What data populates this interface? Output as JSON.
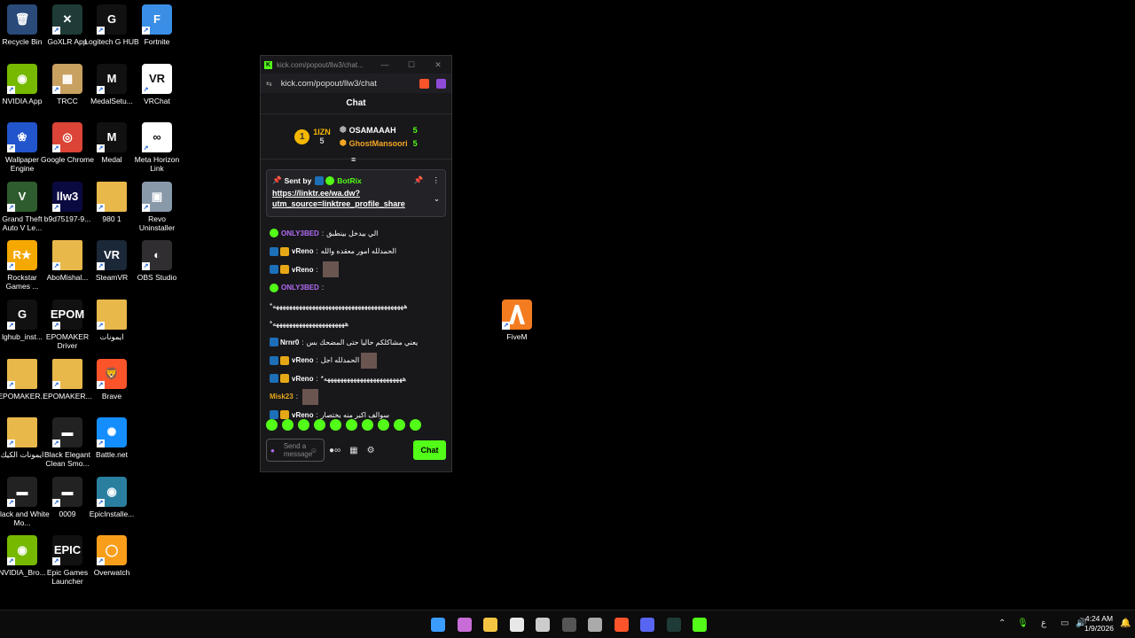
{
  "desktop": {
    "icons": [
      {
        "label": "Recycle Bin",
        "icon": "recycle-bin-icon",
        "color": "#2a4a7a",
        "glyph": "🗑"
      },
      {
        "label": "GoXLR App",
        "icon": "goxlr-icon",
        "color": "#1f3b38",
        "glyph": "✕"
      },
      {
        "label": "Logitech G HUB",
        "icon": "logitech-icon",
        "color": "#111111",
        "glyph": "G"
      },
      {
        "label": "Fortnite",
        "icon": "fortnite-icon",
        "color": "#3a8ee6",
        "glyph": "F"
      },
      {
        "label": "NVIDIA App",
        "icon": "nvidia-icon",
        "color": "#76b900",
        "glyph": "◉"
      },
      {
        "label": "TRCC",
        "icon": "trcc-icon",
        "color": "#c8a060",
        "glyph": "▦"
      },
      {
        "label": "MedalSetu...",
        "icon": "medal-icon",
        "color": "#111111",
        "glyph": "M"
      },
      {
        "label": "VRChat",
        "icon": "vrchat-icon",
        "color": "#ffffff",
        "glyph": "VR"
      },
      {
        "label": "Wallpaper Engine",
        "icon": "wallpaper-engine-icon",
        "color": "#2255cc",
        "glyph": "❀"
      },
      {
        "label": "Google Chrome",
        "icon": "chrome-icon",
        "color": "#db4437",
        "glyph": "◎"
      },
      {
        "label": "Medal",
        "icon": "medal-icon",
        "color": "#111111",
        "glyph": "M"
      },
      {
        "label": "Meta Horizon Link",
        "icon": "meta-icon",
        "color": "#ffffff",
        "glyph": "∞"
      },
      {
        "label": "Grand Theft Auto V Le...",
        "icon": "gta-icon",
        "color": "#2e5c2e",
        "glyph": "V"
      },
      {
        "label": "b9d75197-9...",
        "icon": "llw3-icon",
        "color": "#0a0a40",
        "glyph": "llw3"
      },
      {
        "label": "980 1",
        "icon": "folder-icon",
        "color": "#e8b84a",
        "glyph": ""
      },
      {
        "label": "Revo Uninstaller",
        "icon": "revo-icon",
        "color": "#8899aa",
        "glyph": "▣"
      },
      {
        "label": "Rockstar Games ...",
        "icon": "rockstar-icon",
        "color": "#f5a800",
        "glyph": "R★"
      },
      {
        "label": "AboMishal...",
        "icon": "folder-icon",
        "color": "#e8b84a",
        "glyph": ""
      },
      {
        "label": "SteamVR",
        "icon": "steamvr-icon",
        "color": "#1b2838",
        "glyph": "VR"
      },
      {
        "label": "OBS Studio",
        "icon": "obs-icon",
        "color": "#302e31",
        "glyph": "◐"
      },
      {
        "label": "lghub_inst...",
        "icon": "logitech-icon",
        "color": "#111111",
        "glyph": "G"
      },
      {
        "label": "EPOMAKER Driver",
        "icon": "epomaker-icon",
        "color": "#111111",
        "glyph": "EPOM"
      },
      {
        "label": "ايمونات",
        "icon": "folder-icon",
        "color": "#e8b84a",
        "glyph": ""
      },
      {
        "label": "",
        "icon": "",
        "color": "",
        "glyph": ""
      },
      {
        "label": "EPOMAKER...",
        "icon": "folder-icon",
        "color": "#e8b84a",
        "glyph": ""
      },
      {
        "label": "EPOMAKER...",
        "icon": "folder-icon",
        "color": "#e8b84a",
        "glyph": ""
      },
      {
        "label": "Brave",
        "icon": "brave-icon",
        "color": "#fb542b",
        "glyph": "🦁"
      },
      {
        "label": "",
        "icon": "",
        "color": "",
        "glyph": ""
      },
      {
        "label": "ايمونات الكيك",
        "icon": "folder-icon",
        "color": "#e8b84a",
        "glyph": ""
      },
      {
        "label": "Black Elegant Clean Smo...",
        "icon": "video-icon",
        "color": "#222222",
        "glyph": "▬"
      },
      {
        "label": "Battle.net",
        "icon": "battlenet-icon",
        "color": "#148eff",
        "glyph": "✺"
      },
      {
        "label": "",
        "icon": "",
        "color": "",
        "glyph": ""
      },
      {
        "label": "Black and White Mo...",
        "icon": "video-icon",
        "color": "#222222",
        "glyph": "▬"
      },
      {
        "label": "0009",
        "icon": "video-icon",
        "color": "#222222",
        "glyph": "▬"
      },
      {
        "label": "EpicInstalle...",
        "icon": "installer-icon",
        "color": "#2a7fa0",
        "glyph": "◉"
      },
      {
        "label": "",
        "icon": "",
        "color": "",
        "glyph": ""
      },
      {
        "label": "NVIDIA_Bro...",
        "icon": "nvidia-icon",
        "color": "#76b900",
        "glyph": "◉"
      },
      {
        "label": "Epic Games Launcher",
        "icon": "epic-icon",
        "color": "#111111",
        "glyph": "EPIC"
      },
      {
        "label": "Overwatch",
        "icon": "overwatch-icon",
        "color": "#f99e1a",
        "glyph": "◯"
      }
    ],
    "fivem": {
      "label": "FiveM",
      "icon": "fivem-icon",
      "color": "#f47c20"
    }
  },
  "browser": {
    "tab_title": "kick.com/popout/llw3/chat...",
    "url": "kick.com/popout/llw3/chat",
    "minimize": "—",
    "maximize": "☐",
    "close": "✕",
    "chat_title": "Chat",
    "leaderboard": {
      "rank": "1",
      "left_name": "1IZN",
      "left_count": "5",
      "entries": [
        {
          "name": "OSAMAAAH",
          "count": "5",
          "color": "#ffffff"
        },
        {
          "name": "GhostMansoori",
          "count": "5",
          "color": "#f5a623"
        }
      ]
    },
    "pinned": {
      "sent_by": "Sent by",
      "author": "BotRix",
      "link": "https://linktr.ee/wa.dw?utm_source=linktree_profile_share",
      "link_line1": "https://linktr.ee/wa.dw?",
      "link_line2": "utm_source=linktree_profile_share"
    },
    "messages": [
      {
        "user": "ONLY3BED",
        "color": "#b26cf5",
        "badges": [
          "verified"
        ],
        "text": "الي بيدخل بينطبق"
      },
      {
        "user": "vReno",
        "color": "#ffffff",
        "badges": [
          "sub",
          "crown"
        ],
        "text": "الحمدلله امور معقده والله"
      },
      {
        "user": "vReno",
        "color": "#ffffff",
        "badges": [
          "sub",
          "crown"
        ],
        "text": "",
        "emote": true
      },
      {
        "user": "ONLY3BED",
        "color": "#b26cf5",
        "badges": [
          "verified"
        ],
        "text": ""
      },
      {
        "user": "",
        "color": "#ffffff",
        "badges": [],
        "text": "*ههههههههههههههههههههههههههههههههههههههههه"
      },
      {
        "user": "",
        "color": "#ffffff",
        "badges": [],
        "text": "*ههههههههههههههههههههههه"
      },
      {
        "user": "Nrnr0",
        "color": "#ffffff",
        "badges": [
          "sub"
        ],
        "text": "يعني مشاكلكم حاليا حتى المضحك بس"
      },
      {
        "user": "vReno",
        "color": "#ffffff",
        "badges": [
          "sub",
          "crown"
        ],
        "text": "الحمدلله اجل",
        "emote": true
      },
      {
        "user": "vReno",
        "color": "#ffffff",
        "badges": [
          "sub",
          "crown"
        ],
        "text": "*ههههههههههههههههههههههههه"
      },
      {
        "user": "Misk23",
        "color": "#e6a817",
        "badges": [],
        "text": "",
        "emote": true
      },
      {
        "user": "vReno",
        "color": "#ffffff",
        "badges": [
          "sub",
          "crown"
        ],
        "text": "سوالف اكبر منه بختصار"
      }
    ],
    "input_placeholder": "Send a message",
    "chat_button": "Chat"
  },
  "taskbar": {
    "time": "4:24 AM",
    "date": "1/9/2026",
    "lang": "ع",
    "apps": [
      {
        "icon": "windows-start-icon",
        "color": "#3b9cff"
      },
      {
        "icon": "copilot-icon",
        "color": "#c86dd7"
      },
      {
        "icon": "file-explorer-icon",
        "color": "#f5c542"
      },
      {
        "icon": "notepad-icon",
        "color": "#e8e8e8"
      },
      {
        "icon": "store-icon",
        "color": "#cccccc"
      },
      {
        "icon": "calculator-icon",
        "color": "#555555"
      },
      {
        "icon": "chrome-taskbar-icon",
        "color": "#aaaaaa"
      },
      {
        "icon": "brave-taskbar-icon",
        "color": "#fb542b"
      },
      {
        "icon": "discord-icon",
        "color": "#5865f2"
      },
      {
        "icon": "goxlr-taskbar-icon",
        "color": "#1f3b38"
      },
      {
        "icon": "kick-taskbar-icon",
        "color": "#53fc18"
      }
    ]
  }
}
